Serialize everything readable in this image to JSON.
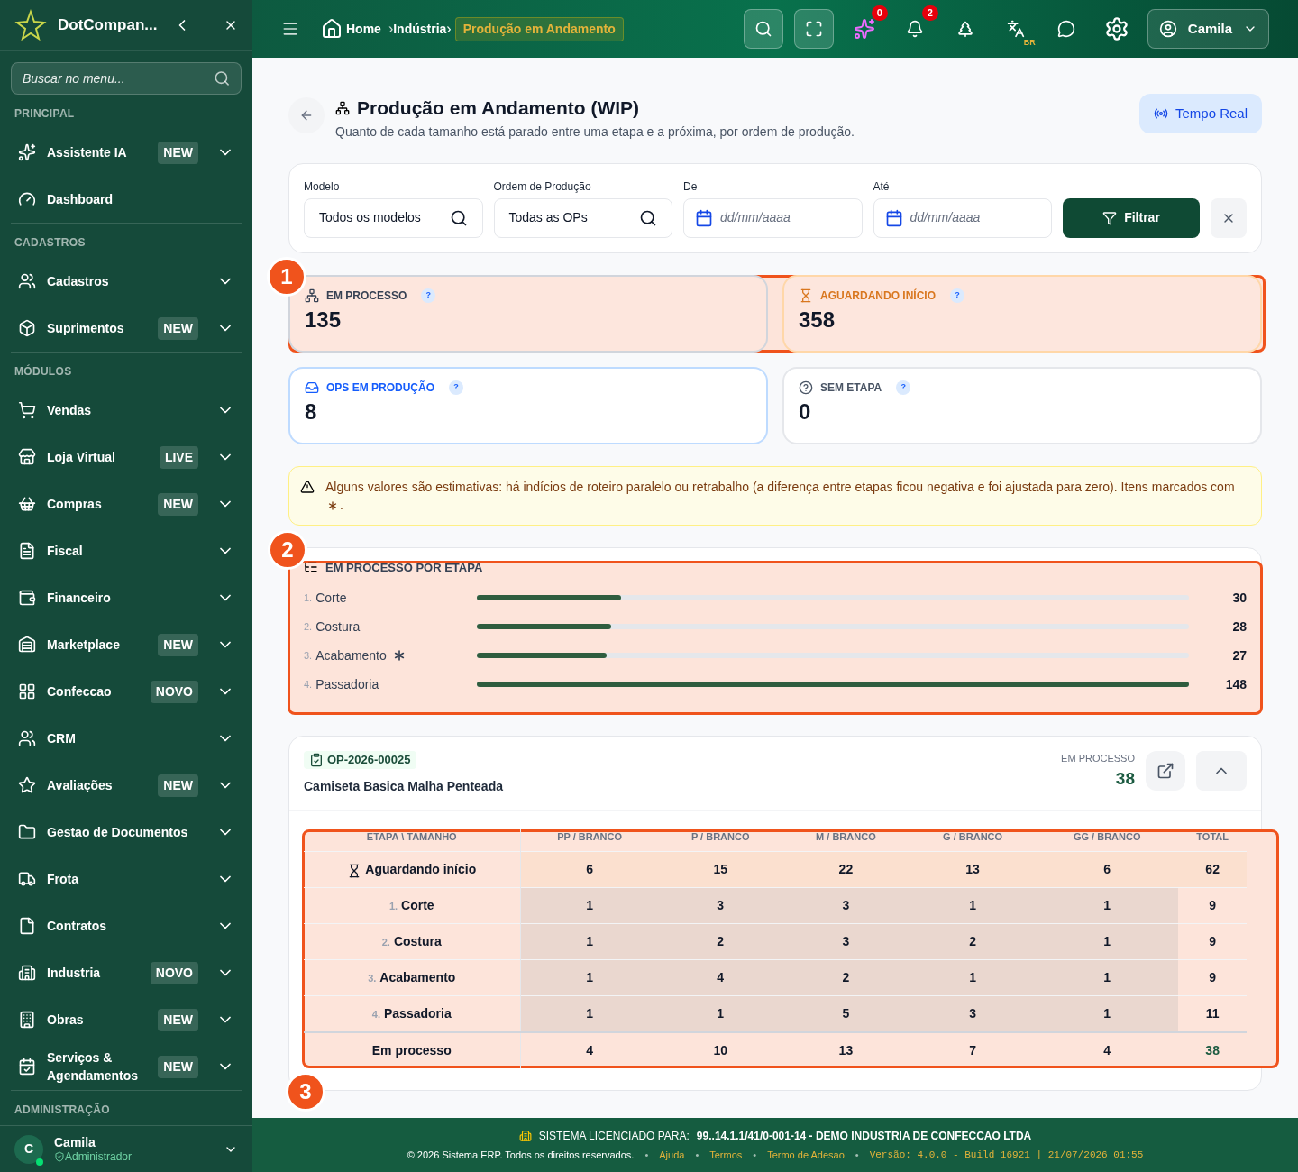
{
  "sidebar": {
    "brand": "DotCompan...",
    "search": {
      "placeholder": "Buscar no menu..."
    },
    "sections": [
      {
        "title": "PRINCIPAL",
        "items": [
          {
            "label": "Assistente IA",
            "badge": "NEW",
            "expandable": true
          },
          {
            "label": "Dashboard",
            "expandable": false
          }
        ]
      },
      {
        "title": "CADASTROS",
        "items": [
          {
            "label": "Cadastros",
            "expandable": true
          },
          {
            "label": "Suprimentos",
            "badge": "NEW",
            "expandable": true
          }
        ]
      },
      {
        "title": "MÓDULOS",
        "items": [
          {
            "label": "Vendas",
            "expandable": true
          },
          {
            "label": "Loja Virtual",
            "badge": "LIVE",
            "expandable": true
          },
          {
            "label": "Compras",
            "badge": "NEW",
            "expandable": true
          },
          {
            "label": "Fiscal",
            "expandable": true
          },
          {
            "label": "Financeiro",
            "expandable": true
          },
          {
            "label": "Marketplace",
            "badge": "NEW",
            "expandable": true
          },
          {
            "label": "Confeccao",
            "badge": "NOVO",
            "expandable": true
          },
          {
            "label": "CRM",
            "expandable": true
          },
          {
            "label": "Avaliações",
            "badge": "NEW",
            "expandable": true
          },
          {
            "label": "Gestao de Documentos",
            "expandable": true
          },
          {
            "label": "Frota",
            "expandable": true
          },
          {
            "label": "Contratos",
            "expandable": true
          },
          {
            "label": "Industria",
            "badge": "NOVO",
            "expandable": true
          },
          {
            "label": "Obras",
            "badge": "NEW",
            "expandable": true
          },
          {
            "label": "Serviços & Agendamentos",
            "badge": "NEW",
            "expandable": true
          }
        ]
      },
      {
        "title": "ADMINISTRAÇÃO"
      }
    ],
    "user": {
      "initial": "C",
      "name": "Camila",
      "role": "Administrador"
    }
  },
  "header": {
    "breadcrumbs": [
      {
        "label": "Home"
      },
      {
        "separator": "›",
        "label": "Indústria"
      }
    ],
    "current_separator": "›",
    "current": "Produção em Andamento",
    "ai_count": "0",
    "notifications": "2",
    "language": "BR",
    "user": "Camila"
  },
  "page": {
    "title": "Produção em Andamento (WIP)",
    "subtitle": "Quanto de cada tamanho está parado entre uma etapa e a próxima, por ordem de produção.",
    "realtime_button": "Tempo Real"
  },
  "filters": {
    "fields": [
      {
        "label": "Modelo",
        "value": "Todos os modelos",
        "kind": "search"
      },
      {
        "label": "Ordem de Produção",
        "value": "Todas as OPs",
        "kind": "search"
      },
      {
        "label": "De",
        "placeholder": "dd/mm/aaaa",
        "kind": "date"
      },
      {
        "label": "Até",
        "placeholder": "dd/mm/aaaa",
        "kind": "date"
      }
    ],
    "filter_button": "Filtrar"
  },
  "stats_callout": "1",
  "stats": [
    {
      "label": "EM PROCESSO",
      "value": "135",
      "kind": "process"
    },
    {
      "label": "AGUARDANDO INÍCIO",
      "value": "358",
      "kind": "waiting"
    },
    {
      "label": "OPS EM PRODUÇÃO",
      "value": "8",
      "kind": "ops"
    },
    {
      "label": "SEM ETAPA",
      "value": "0",
      "kind": "none"
    }
  ],
  "stats_help": "?",
  "warning": "Alguns valores são estimativas: há indícios de roteiro paralelo ou retrabalho (a diferença entre etapas ficou negativa e foi ajustada para zero). Itens marcados com",
  "warning_end": ".",
  "stages_card": {
    "title": "EM PROCESSO POR ETAPA",
    "callout": "2",
    "stages": [
      {
        "number": "1.",
        "name": "Corte",
        "level": 0.203,
        "value": "30",
        "estimated": false
      },
      {
        "number": "2.",
        "name": "Costura",
        "level": 0.189,
        "value": "28",
        "estimated": false
      },
      {
        "number": "3.",
        "name": "Acabamento",
        "level": 0.182,
        "value": "27",
        "estimated": true
      },
      {
        "number": "4.",
        "name": "Passadoria",
        "level": 1,
        "value": "148",
        "estimated": false
      }
    ]
  },
  "order": {
    "code": "OP-2026-00025",
    "product": "Camiseta Basica Malha Penteada",
    "metric_label": "EM PROCESSO",
    "metric_value": "38",
    "expanded": true,
    "table": {
      "callout": "3",
      "row_header": "ETAPA \\ TAMANHO",
      "columns": [
        "PP / BRANCO",
        "P / BRANCO",
        "M / BRANCO",
        "G / BRANCO",
        "GG / BRANCO"
      ],
      "total_header": "TOTAL",
      "rows": [
        {
          "kind": "waiting",
          "label": "Aguardando início",
          "cells": [
            "6",
            "15",
            "22",
            "13",
            "6"
          ],
          "total": "62"
        },
        {
          "kind": "stage",
          "number": "1.",
          "label": "Corte",
          "cells": [
            "1",
            "3",
            "3",
            "1",
            "1"
          ],
          "total": "9"
        },
        {
          "kind": "stage",
          "number": "2.",
          "label": "Costura",
          "cells": [
            "1",
            "2",
            "3",
            "2",
            "1"
          ],
          "total": "9"
        },
        {
          "kind": "stage",
          "number": "3.",
          "label": "Acabamento",
          "cells": [
            "1",
            "4",
            "2",
            "1",
            "1"
          ],
          "total": "9"
        },
        {
          "kind": "stage",
          "number": "4.",
          "label": "Passadoria",
          "cells": [
            "1",
            "1",
            "5",
            "3",
            "1"
          ],
          "total": "11"
        },
        {
          "kind": "sum",
          "label": "Em processo",
          "cells": [
            "4",
            "10",
            "13",
            "7",
            "4"
          ],
          "total": "38"
        }
      ]
    }
  },
  "footer": {
    "license_label": "SISTEMA LICENCIADO PARA:",
    "license_value": "99..14.1.1/41/0-001-14 - DEMO INDUSTRIA DE CONFECCAO LTDA",
    "copyright": "© 2026 Sistema ERP. Todos os direitos reservados.",
    "separator": "•",
    "links": [
      "Ajuda",
      "Termos",
      "Termo de Adesao"
    ],
    "version": "Versão: 4.0.0 - Build 16921 | 21/07/2026 01:55"
  }
}
